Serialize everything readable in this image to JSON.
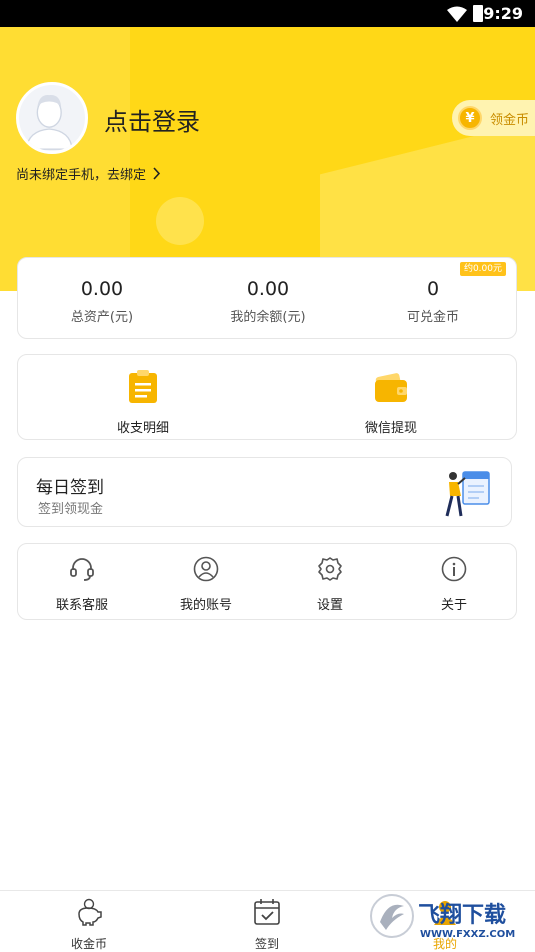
{
  "status_bar": {
    "time": "9:29"
  },
  "header": {
    "login_title": "点击登录",
    "bind_phone": "尚未绑定手机，去绑定",
    "coin_button": {
      "symbol": "¥",
      "label": "领金币"
    }
  },
  "stats": {
    "badge": "约0.00元",
    "items": [
      {
        "value": "0.00",
        "label": "总资产(元)"
      },
      {
        "value": "0.00",
        "label": "我的余额(元)"
      },
      {
        "value": "0",
        "label": "可兑金币"
      }
    ]
  },
  "actions": [
    {
      "label": "收支明细",
      "icon": "clipboard-icon"
    },
    {
      "label": "微信提现",
      "icon": "wallet-icon"
    }
  ],
  "daily_signin": {
    "title": "每日签到",
    "subtitle": "签到领现金"
  },
  "menu": [
    {
      "label": "联系客服",
      "icon": "headset-icon"
    },
    {
      "label": "我的账号",
      "icon": "user-icon"
    },
    {
      "label": "设置",
      "icon": "gear-icon"
    },
    {
      "label": "关于",
      "icon": "info-icon"
    }
  ],
  "tabbar": [
    {
      "label": "收金币",
      "icon": "piggy-bank-icon"
    },
    {
      "label": "签到",
      "icon": "calendar-check-icon"
    },
    {
      "label": "我的",
      "icon": "user-icon"
    }
  ],
  "watermark": {
    "text": "飞翔下载",
    "url_text": "WWW.FXXZ.COM"
  },
  "colors": {
    "brand_yellow": "#ffd817",
    "accent_orange": "#f7b500",
    "tab_active": "#e8a400"
  }
}
